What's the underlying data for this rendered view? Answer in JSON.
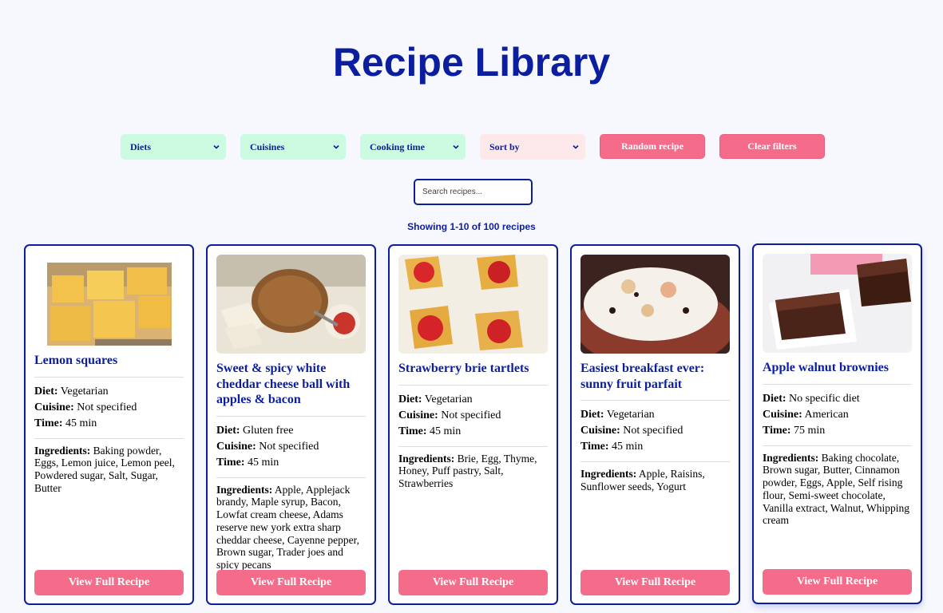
{
  "header": {
    "title": "Recipe Library"
  },
  "filters": {
    "diets": "Diets",
    "cuisines": "Cuisines",
    "cooking_time": "Cooking time",
    "sort_by": "Sort by",
    "random_label": "Random recipe",
    "clear_label": "Clear filters"
  },
  "search": {
    "placeholder": "Search recipes..."
  },
  "results": {
    "showing": "Showing 1-10 of 100 recipes"
  },
  "labels": {
    "diet": "Diet:",
    "cuisine": "Cuisine:",
    "time": "Time:",
    "ingredients": "Ingredients:",
    "view": "View Full Recipe"
  },
  "recipes": [
    {
      "title": "Lemon squares",
      "diet": "Vegetarian",
      "cuisine": "Not specified",
      "time": "45 min",
      "ingredients": "Baking powder, Eggs, Lemon juice, Lemon peel, Powdered sugar, Salt, Sugar, Butter"
    },
    {
      "title": "Sweet & spicy white cheddar cheese ball with apples & bacon",
      "diet": "Gluten free",
      "cuisine": "Not specified",
      "time": "45 min",
      "ingredients": "Apple, Applejack brandy, Maple syrup, Bacon, Lowfat cream cheese, Adams reserve new york extra sharp cheddar cheese, Cayenne pepper, Brown sugar, Trader joes and spicy pecans"
    },
    {
      "title": "Strawberry brie tartlets",
      "diet": "Vegetarian",
      "cuisine": "Not specified",
      "time": "45 min",
      "ingredients": "Brie, Egg, Thyme, Honey, Puff pastry, Salt, Strawberries"
    },
    {
      "title": "Easiest breakfast ever: sunny fruit parfait",
      "diet": "Vegetarian",
      "cuisine": "Not specified",
      "time": "45 min",
      "ingredients": "Apple, Raisins, Sunflower seeds, Yogurt"
    },
    {
      "title": "Apple walnut brownies",
      "diet": "No specific diet",
      "cuisine": "American",
      "time": "75 min",
      "ingredients": "Baking chocolate, Brown sugar, Butter, Cinnamon powder, Eggs, Apple, Self rising flour, Semi-sweet chocolate, Vanilla extract, Walnut, Whipping cream"
    }
  ],
  "colors": {
    "brand": "#0b1ea0",
    "accent": "#f56b8a",
    "select_bg": "#cdfbe2",
    "sort_bg": "#fde8ea"
  }
}
